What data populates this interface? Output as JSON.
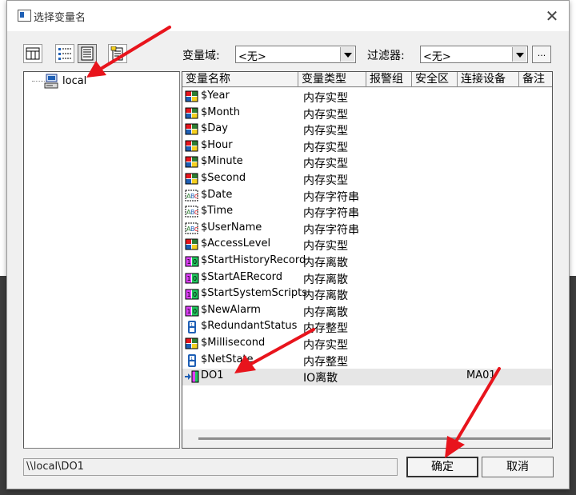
{
  "dialog": {
    "title": "选择变量名",
    "close_glyph": "✕"
  },
  "toolbar": {
    "icons": [
      "grid-view-icon",
      "tree-list-icon",
      "detail-list-icon",
      "document-icon"
    ]
  },
  "filters": {
    "domain_label": "变量域:",
    "domain_value": "<无>",
    "filter_label": "过滤器:",
    "filter_value": "<无>",
    "more_label": "..."
  },
  "tree": {
    "root_label": "local"
  },
  "list": {
    "columns": [
      "变量名称",
      "变量类型",
      "报警组",
      "安全区",
      "连接设备",
      "备注"
    ],
    "rows": [
      {
        "name": "$Year",
        "type": "内存实型",
        "device": "",
        "icon": "real-var-icon"
      },
      {
        "name": "$Month",
        "type": "内存实型",
        "device": "",
        "icon": "real-var-icon"
      },
      {
        "name": "$Day",
        "type": "内存实型",
        "device": "",
        "icon": "real-var-icon"
      },
      {
        "name": "$Hour",
        "type": "内存实型",
        "device": "",
        "icon": "real-var-icon"
      },
      {
        "name": "$Minute",
        "type": "内存实型",
        "device": "",
        "icon": "real-var-icon"
      },
      {
        "name": "$Second",
        "type": "内存实型",
        "device": "",
        "icon": "real-var-icon"
      },
      {
        "name": "$Date",
        "type": "内存字符串",
        "device": "",
        "icon": "string-var-icon"
      },
      {
        "name": "$Time",
        "type": "内存字符串",
        "device": "",
        "icon": "string-var-icon"
      },
      {
        "name": "$UserName",
        "type": "内存字符串",
        "device": "",
        "icon": "string-var-icon"
      },
      {
        "name": "$AccessLevel",
        "type": "内存实型",
        "device": "",
        "icon": "real-var-icon"
      },
      {
        "name": "$StartHistoryRecord",
        "type": "内存离散",
        "device": "",
        "icon": "discrete-var-icon"
      },
      {
        "name": "$StartAERecord",
        "type": "内存离散",
        "device": "",
        "icon": "discrete-var-icon"
      },
      {
        "name": "$StartSystemScripts",
        "type": "内存离散",
        "device": "",
        "icon": "discrete-var-icon"
      },
      {
        "name": "$NewAlarm",
        "type": "内存离散",
        "device": "",
        "icon": "discrete-var-icon"
      },
      {
        "name": "$RedundantStatus",
        "type": "内存整型",
        "device": "",
        "icon": "integer-var-icon"
      },
      {
        "name": "$Millisecond",
        "type": "内存实型",
        "device": "",
        "icon": "real-var-icon"
      },
      {
        "name": "$NetState",
        "type": "内存整型",
        "device": "",
        "icon": "integer-var-icon"
      },
      {
        "name": "DO1",
        "type": "IO离散",
        "device": "MA01",
        "icon": "io-discrete-var-icon"
      }
    ]
  },
  "footer": {
    "path": "\\\\local\\DO1",
    "ok_label": "确定",
    "cancel_label": "取消"
  },
  "colors": {
    "annotation_arrow": "#e8141c",
    "selection": "#e6e6e6"
  }
}
